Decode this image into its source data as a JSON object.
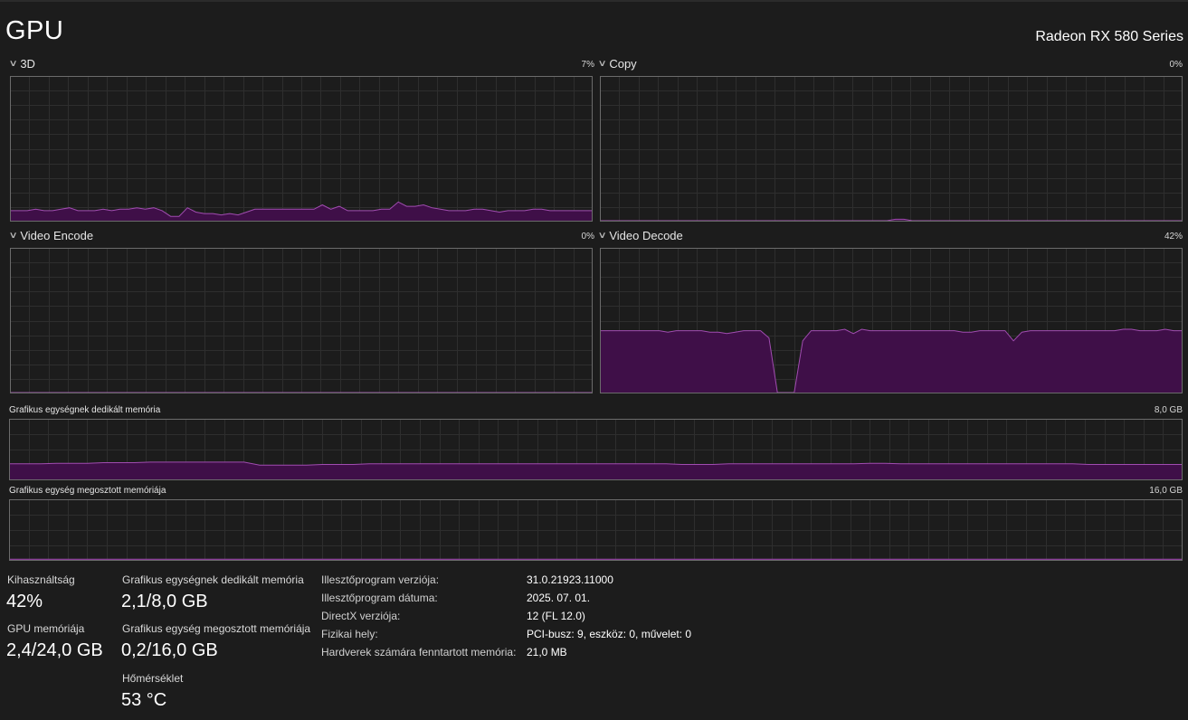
{
  "header": {
    "title": "GPU",
    "adapter_name": "Radeon RX 580 Series"
  },
  "colors": {
    "background": "#1c1c1c",
    "grid_line": "#2e2e2e",
    "graph_border": "#6b6b6b",
    "fill": "#3f0f48",
    "line": "#a04cb0"
  },
  "engines": [
    {
      "label": "3D",
      "value": "7%",
      "samples": [
        7,
        7,
        7,
        8,
        7,
        7,
        8,
        9,
        7,
        7,
        7,
        8,
        7,
        8,
        8,
        9,
        8,
        9,
        7,
        3,
        3,
        9,
        6,
        5,
        5,
        4,
        5,
        4,
        6,
        8,
        8,
        8,
        8,
        8,
        8,
        8,
        8,
        11,
        8,
        10,
        7,
        7,
        7,
        7,
        8,
        8,
        13,
        10,
        10,
        11,
        9,
        8,
        7,
        7,
        7,
        8,
        8,
        7,
        6,
        7,
        7,
        7,
        8,
        8,
        7,
        7,
        7,
        7,
        7,
        7
      ]
    },
    {
      "label": "Copy",
      "value": "0%",
      "samples": [
        0,
        0,
        0,
        0,
        0,
        0,
        0,
        0,
        0,
        0,
        0,
        0,
        0,
        0,
        0,
        0,
        0,
        0,
        0,
        0,
        0,
        0,
        0,
        0,
        0,
        0,
        0,
        0,
        0,
        0,
        0,
        0,
        0,
        0,
        0,
        1,
        1,
        0,
        0,
        0,
        0,
        0,
        0,
        0,
        0,
        0,
        0,
        0,
        0,
        0,
        0,
        0,
        0,
        0,
        0,
        0,
        0,
        0,
        0,
        0,
        0,
        0,
        0,
        0,
        0,
        0,
        0,
        0,
        0,
        0
      ]
    },
    {
      "label": "Video Encode",
      "value": "0%",
      "samples": [
        0,
        0,
        0,
        0,
        0,
        0,
        0,
        0,
        0,
        0,
        0,
        0,
        0,
        0,
        0,
        0,
        0,
        0,
        0,
        0,
        0,
        0,
        0,
        0,
        0,
        0,
        0,
        0,
        0,
        0,
        0,
        0,
        0,
        0,
        0,
        0,
        0,
        0,
        0,
        0,
        0,
        0,
        0,
        0,
        0,
        0,
        0,
        0,
        0,
        0,
        0,
        0,
        0,
        0,
        0,
        0,
        0,
        0,
        0,
        0,
        0,
        0,
        0,
        0,
        0,
        0,
        0,
        0,
        0,
        0
      ]
    },
    {
      "label": "Video Decode",
      "value": "42%",
      "samples": [
        43,
        43,
        43,
        43,
        43,
        43,
        43,
        43,
        42,
        43,
        43,
        43,
        43,
        42,
        42,
        41,
        42,
        43,
        43,
        43,
        38,
        0,
        0,
        0,
        36,
        43,
        43,
        43,
        43,
        44,
        41,
        44,
        43,
        43,
        43,
        43,
        43,
        43,
        43,
        43,
        43,
        43,
        43,
        42,
        42,
        43,
        43,
        43,
        43,
        36,
        42,
        43,
        43,
        43,
        43,
        43,
        43,
        43,
        43,
        43,
        43,
        43,
        44,
        44,
        43,
        43,
        43,
        44,
        43,
        43
      ]
    }
  ],
  "memory_graphs": [
    {
      "label": "Grafikus egységnek dedikált memória",
      "value": "8,0 GB",
      "samples": [
        26,
        26,
        26,
        27,
        27,
        27,
        28,
        28,
        28,
        29,
        29,
        29,
        29,
        29,
        29,
        29,
        24,
        24,
        24,
        24,
        25,
        25,
        25,
        26,
        26,
        26,
        26,
        26,
        26,
        26,
        26,
        26,
        26,
        26,
        26,
        26,
        26,
        26,
        26,
        26,
        26,
        26,
        26,
        25,
        25,
        25,
        26,
        26,
        26,
        26,
        26,
        26,
        26,
        26,
        26,
        27,
        27,
        26,
        26,
        26,
        26,
        26,
        26,
        26,
        26,
        26,
        26,
        26,
        26,
        25,
        25,
        25,
        25,
        25,
        25,
        25
      ]
    },
    {
      "label": "Grafikus egység megosztott memóriája",
      "value": "16,0 GB",
      "samples": [
        1,
        1,
        1,
        1,
        1,
        1,
        1,
        1,
        1,
        1,
        1,
        1,
        1,
        1,
        1,
        1,
        1,
        1,
        1,
        1,
        1,
        1,
        1,
        1,
        1,
        1,
        1,
        1,
        1,
        1,
        1,
        1,
        1,
        1,
        1,
        1,
        1,
        1,
        1,
        1,
        1,
        1,
        1,
        1,
        1,
        1,
        1,
        1,
        1,
        1,
        1,
        1,
        1,
        1,
        1,
        1,
        1,
        1,
        1,
        1,
        1,
        1,
        1,
        1,
        1,
        1,
        1,
        1,
        1,
        1,
        1,
        1,
        1,
        1,
        1,
        1
      ]
    }
  ],
  "stats": {
    "utilization_label": "Kihasználtság",
    "utilization_value": "42%",
    "gpu_memory_label": "GPU memóriája",
    "gpu_memory_value": "2,4/24,0 GB",
    "dedicated_label": "Grafikus egységnek dedikált memória",
    "dedicated_value": "2,1/8,0 GB",
    "shared_label": "Grafikus egység megosztott memóriája",
    "shared_value": "0,2/16,0 GB",
    "temperature_label": "Hőmérséklet",
    "temperature_value": "53 °C"
  },
  "info": [
    {
      "label": "Illesztőprogram verziója:",
      "value": "31.0.21923.11000"
    },
    {
      "label": "Illesztőprogram dátuma:",
      "value": "2025. 07. 01."
    },
    {
      "label": "DirectX verziója:",
      "value": "12 (FL 12.0)"
    },
    {
      "label": "Fizikai hely:",
      "value": "PCI-busz: 9, eszköz: 0, művelet: 0"
    },
    {
      "label": "Hardverek számára fenntartott memória:",
      "value": "21,0 MB"
    }
  ]
}
